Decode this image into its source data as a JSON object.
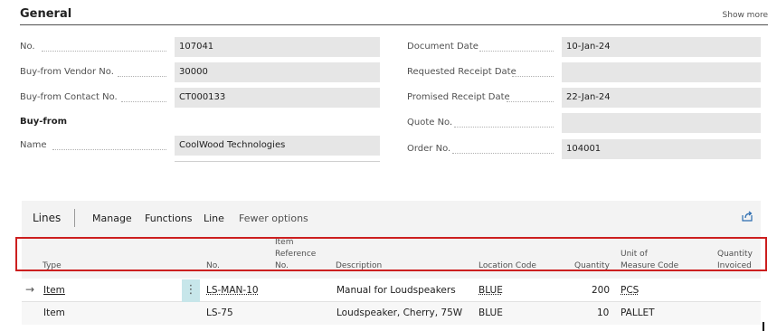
{
  "general": {
    "title": "General",
    "show_more": "Show more",
    "left_fields": [
      {
        "label": "No.",
        "value": "107041"
      },
      {
        "label": "Buy-from Vendor No.",
        "value": "30000"
      },
      {
        "label": "Buy-from Contact No.",
        "value": "CT000133"
      }
    ],
    "buy_from_group": "Buy-from",
    "name_field": {
      "label": "Name",
      "value": "CoolWood Technologies"
    },
    "right_fields": [
      {
        "label": "Document Date",
        "value": "10-Jan-24"
      },
      {
        "label": "Requested Receipt Date",
        "value": ""
      },
      {
        "label": "Promised Receipt Date",
        "value": "22-Jan-24"
      },
      {
        "label": "Quote No.",
        "value": ""
      },
      {
        "label": "Order No.",
        "value": "104001"
      }
    ]
  },
  "lines": {
    "title": "Lines",
    "menu": [
      "Manage",
      "Functions",
      "Line",
      "Fewer options"
    ],
    "columns": {
      "type": "Type",
      "no": "No.",
      "item_ref_1": "Item",
      "item_ref_2": "Reference",
      "item_ref_3": "No.",
      "description": "Description",
      "location": "Location Code",
      "quantity": "Quantity",
      "uom_1": "Unit of",
      "uom_2": "Measure Code",
      "qty_inv_1": "Quantity",
      "qty_inv_2": "Invoiced"
    },
    "rows": [
      {
        "type": "Item",
        "no": "LS-MAN-10",
        "description": "Manual for Loudspeakers",
        "location": "BLUE",
        "quantity": "200",
        "uom": "PCS"
      },
      {
        "type": "Item",
        "no": "LS-75",
        "description": "Loudspeaker, Cherry, 75W",
        "location": "BLUE",
        "quantity": "10",
        "uom": "PALLET"
      }
    ]
  },
  "icons": {
    "row_arrow": "→",
    "row_menu": "⋮"
  }
}
